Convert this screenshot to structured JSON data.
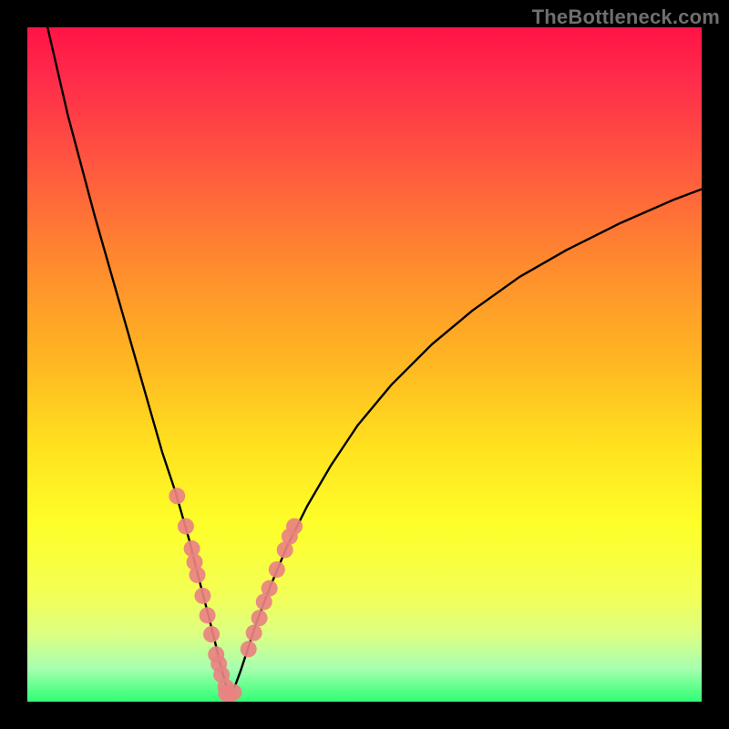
{
  "watermark": "TheBottleneck.com",
  "chart_data": {
    "type": "line",
    "title": "",
    "xlabel": "",
    "ylabel": "",
    "xlim": [
      0,
      100
    ],
    "ylim": [
      0,
      100
    ],
    "grid": false,
    "legend": false,
    "series": [
      {
        "name": "curve",
        "type": "line",
        "color": "#000000",
        "x": [
          3,
          6,
          10,
          14,
          18,
          20,
          22,
          24,
          25.5,
          26.8,
          27.8,
          28.6,
          29.2,
          29.6,
          30,
          30.4,
          30.9,
          31.6,
          32.6,
          34,
          36,
          38.5,
          41.5,
          45,
          49,
          54,
          60,
          66,
          73,
          80,
          88,
          96,
          100
        ],
        "y": [
          100,
          87,
          72,
          58,
          44,
          37,
          31,
          24,
          18,
          13,
          9,
          5.6,
          3.4,
          1.9,
          1,
          1.5,
          2.6,
          4.5,
          7.5,
          11.8,
          17,
          23,
          29,
          35,
          41,
          47,
          53,
          58,
          63,
          67,
          71,
          74.5,
          76
        ]
      },
      {
        "name": "points-left",
        "type": "scatter",
        "color": "#e98282",
        "x": [
          22.2,
          23.5,
          24.4,
          24.8,
          25.2,
          26.0,
          26.7,
          27.3,
          28.0,
          28.4,
          28.8,
          29.4
        ],
        "y": [
          30.5,
          26.0,
          22.7,
          20.7,
          18.8,
          15.7,
          12.8,
          10.0,
          7.0,
          5.6,
          4.0,
          2.2
        ]
      },
      {
        "name": "points-bottom",
        "type": "scatter",
        "color": "#e98282",
        "x": [
          29.5,
          30.0,
          30.6
        ],
        "y": [
          1.2,
          1.0,
          1.4
        ]
      },
      {
        "name": "points-right",
        "type": "scatter",
        "color": "#e98282",
        "x": [
          32.8,
          33.6,
          34.4,
          35.1,
          35.9,
          37.0,
          38.2,
          38.9,
          39.6
        ],
        "y": [
          7.8,
          10.2,
          12.4,
          14.8,
          16.8,
          19.6,
          22.5,
          24.5,
          26.0
        ]
      }
    ]
  }
}
